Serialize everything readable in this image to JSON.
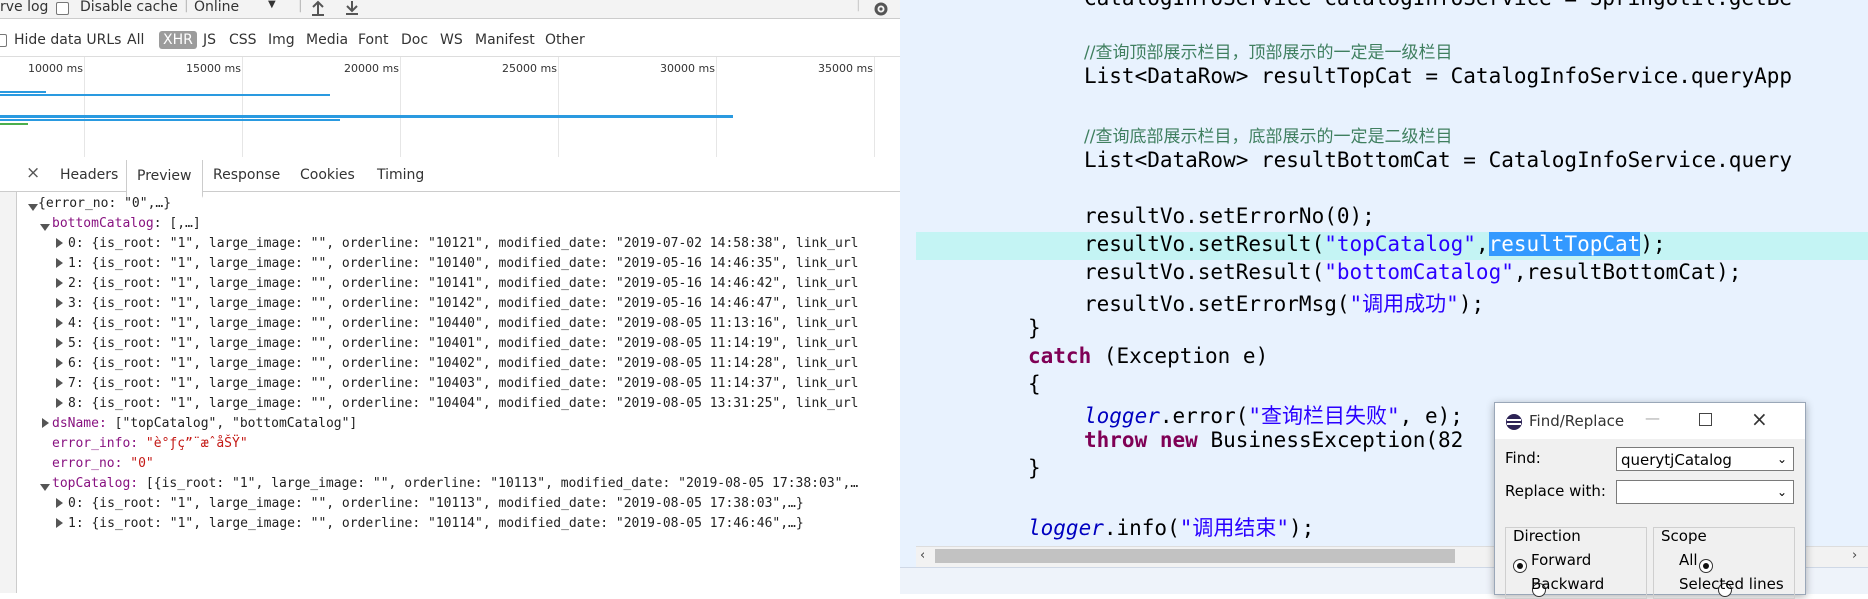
{
  "devtools": {
    "toolbar": {
      "preserve_log_fragment": "rve log",
      "disable_cache_label": "Disable cache",
      "throttle_value": "Online"
    },
    "filter": {
      "hide_data_urls_label": "Hide data URLs",
      "types": [
        "All",
        "XHR",
        "JS",
        "CSS",
        "Img",
        "Media",
        "Font",
        "Doc",
        "WS",
        "Manifest",
        "Other"
      ],
      "active_type": "XHR"
    },
    "timeline": {
      "ticks": [
        "10000 ms",
        "15000 ms",
        "20000 ms",
        "25000 ms",
        "30000 ms",
        "35000 ms"
      ],
      "bar_color": "#2a9ae0"
    },
    "detail_tabs": [
      "Headers",
      "Preview",
      "Response",
      "Cookies",
      "Timing"
    ],
    "active_tab": "Preview",
    "preview": {
      "root": "{error_no: \"0\",…}",
      "bottomCatalog_key": "bottomCatalog",
      "bottomCatalog_summary": "[,…]",
      "bottomCatalog_items": [
        "0: {is_root: \"1\", large_image: \"\", orderline: \"10121\", modified_date: \"2019-07-02 14:58:38\", link_url",
        "1: {is_root: \"1\", large_image: \"\", orderline: \"10140\", modified_date: \"2019-05-16 14:46:35\", link_url",
        "2: {is_root: \"1\", large_image: \"\", orderline: \"10141\", modified_date: \"2019-05-16 14:46:42\", link_url",
        "3: {is_root: \"1\", large_image: \"\", orderline: \"10142\", modified_date: \"2019-05-16 14:46:47\", link_url",
        "4: {is_root: \"1\", large_image: \"\", orderline: \"10440\", modified_date: \"2019-08-05 11:13:16\", link_url",
        "5: {is_root: \"1\", large_image: \"\", orderline: \"10401\", modified_date: \"2019-08-05 11:14:19\", link_url",
        "6: {is_root: \"1\", large_image: \"\", orderline: \"10402\", modified_date: \"2019-08-05 11:14:28\", link_url",
        "7: {is_root: \"1\", large_image: \"\", orderline: \"10403\", modified_date: \"2019-08-05 11:14:37\", link_url",
        "8: {is_root: \"1\", large_image: \"\", orderline: \"10404\", modified_date: \"2019-08-05 13:31:25\", link_url"
      ],
      "dsName_key": "dsName:",
      "dsName_value": " [\"topCatalog\", \"bottomCatalog\"]",
      "error_info_key": "error_info:",
      "error_info_value": " \"è°ƒç”¨æˆåŠŸ\"",
      "error_no_key": "error_no:",
      "error_no_value": " \"0\"",
      "topCatalog_key": "topCatalog:",
      "topCatalog_summary": " [{is_root: \"1\", large_image: \"\", orderline: \"10113\", modified_date: \"2019-08-05 17:38:03\",…",
      "topCatalog_items": [
        "0: {is_root: \"1\", large_image: \"\", orderline: \"10113\", modified_date: \"2019-08-05 17:38:03\",…}",
        "1: {is_root: \"1\", large_image: \"\", orderline: \"10114\", modified_date: \"2019-08-05 17:46:46\",…}"
      ]
    }
  },
  "editor": {
    "lines": {
      "l0_text": "CatalogInfoService catalogInfoService = SpringUtil.getBe",
      "c1": "//查询顶部展示栏目，顶部展示的一定是一级栏目",
      "l2_pre": "List<DataRow> resultTopCat = CatalogInfoService.queryApp",
      "c3": "//查询底部展示栏目，底部展示的一定是二级栏目",
      "l4_pre": "List<DataRow> resultBottomCat = CatalogInfoService.query",
      "l5": "resultVo.setErrorNo(0);",
      "l6_a": "resultVo.setResult(",
      "l6_str": "\"topCatalog\"",
      "l6_comma": ",",
      "l6_sel": "resultTopCat",
      "l6_end": ");",
      "l7_a": "resultVo.setResult(",
      "l7_str": "\"bottomCatalog\"",
      "l7_end": ",resultBottomCat);",
      "l8_a": "resultVo.setErrorMsg(",
      "l8_str": "\"调用成功\"",
      "l8_end": ");",
      "l9": "}",
      "l10_kw": "catch",
      "l10_rest": " (Exception e)",
      "l11": "{",
      "l12_logger": "logger",
      "l12_mid": ".error(",
      "l12_str": "\"查询栏目失败\"",
      "l12_end": ", e);",
      "l13_throw": "throw",
      "l13_new": "new",
      "l13_rest": " BusinessException(82",
      "l14": "}",
      "l15_logger": "logger",
      "l15_mid": ".info(",
      "l15_str": "\"调用结束\"",
      "l15_end": ");"
    }
  },
  "find_replace": {
    "title": "Find/Replace",
    "find_label": "Find:",
    "find_value": "querytjCatalog",
    "replace_label": "Replace with:",
    "replace_value": "",
    "direction_label": "Direction",
    "forward_label": "Forward",
    "backward_label": "Backward",
    "scope_label": "Scope",
    "all_label": "All",
    "selected_lines_label": "Selected lines"
  },
  "colors": {
    "editor_bg": "#e8f2fe",
    "current_line": "#c4f4f4",
    "selection": "#3399ff",
    "keyword": "#7f0055",
    "string": "#2a00ff",
    "comment": "#3f7f5f",
    "field": "#0000c0"
  }
}
